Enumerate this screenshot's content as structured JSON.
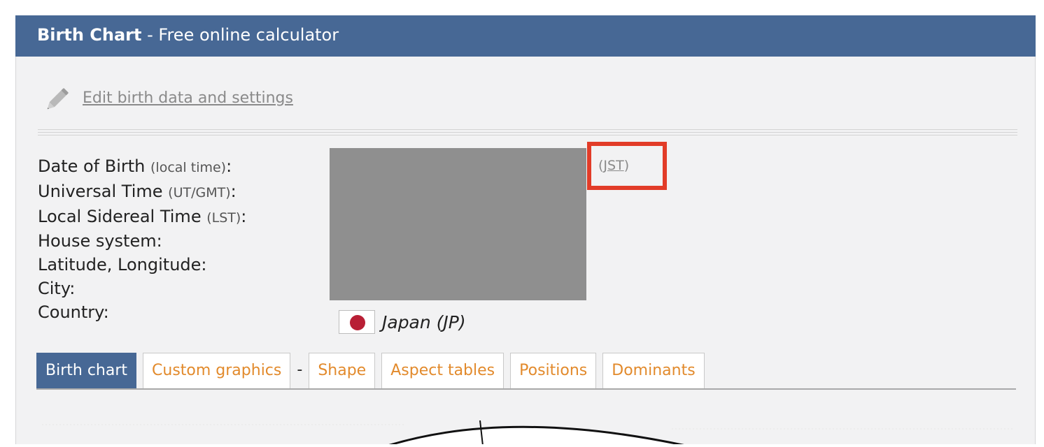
{
  "header": {
    "title_strong": "Birth Chart",
    "title_rest": " - Free online calculator"
  },
  "edit": {
    "icon": "pencil-icon",
    "link_label": "Edit birth data and settings"
  },
  "details": {
    "date_of_birth": {
      "label": "Date of Birth",
      "note": "(local time)",
      "colon": ":"
    },
    "universal_time": {
      "label": "Universal Time",
      "note": "(UT/GMT)",
      "colon": ":"
    },
    "sidereal_time": {
      "label": "Local Sidereal Time",
      "note": "(LST)",
      "colon": ":"
    },
    "house_system": {
      "label": "House system:"
    },
    "lat_long": {
      "label": "Latitude, Longitude:"
    },
    "city": {
      "label": "City:"
    },
    "country": {
      "label": "Country:"
    }
  },
  "timezone": {
    "open": "(",
    "code": "JST",
    "close": ")"
  },
  "country": {
    "flag_icon": "japan-flag-icon",
    "name": "Japan (JP)"
  },
  "tabs": {
    "birth_chart": "Birth chart",
    "custom_graphics": "Custom graphics",
    "separator": "-",
    "shape": "Shape",
    "aspect_tables": "Aspect tables",
    "positions": "Positions",
    "dominants": "Dominants"
  },
  "colors": {
    "header_bg": "#476895",
    "tab_text": "#e28a2c",
    "highlight_box": "#e23c28",
    "flag_red": "#b81f35"
  }
}
